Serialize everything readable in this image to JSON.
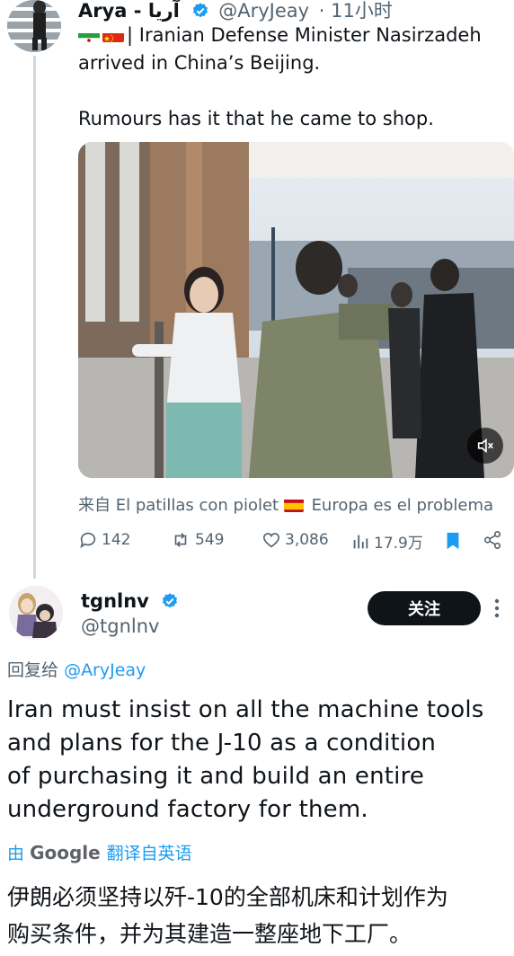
{
  "tweet": {
    "display_name": "Arya - آریا",
    "handle": "@AryJeay",
    "time": "· 11小时",
    "text_line1": "| Iranian Defense Minister Nasirzadeh",
    "text_line2": "arrived in China’s Beijing.",
    "text_line3": "Rumours has it that he came to shop.",
    "source_prefix": "来自",
    "source_name": "El patillas con piolet",
    "source_suffix": "Europa es el problema",
    "replies": "142",
    "reposts": "549",
    "likes": "3,086",
    "views": "17.9万"
  },
  "reply": {
    "display_name": "tgnlnv",
    "handle": "@tgnlnv",
    "follow_label": "关注",
    "reply_to_prefix": "回复给",
    "reply_to_handle": "@AryJeay",
    "body_line1": "Iran must insist on all the machine tools",
    "body_line2": "and plans for the J-10 as a condition",
    "body_line3": "of purchasing it and build an entire",
    "body_line4": "underground factory for them.",
    "translate_prefix": "由",
    "translate_brand": "Google",
    "translate_suffix": "翻译自英语",
    "translated_line1": "伊朗必须坚持以歼-10的全部机床和计划作为",
    "translated_line2": "购买条件，并为其建造一整座地下工厂。"
  },
  "colors": {
    "accent": "#1d9bf0",
    "text": "#0f1419",
    "muted": "#536471",
    "bookmark": "#1d9bf0"
  }
}
